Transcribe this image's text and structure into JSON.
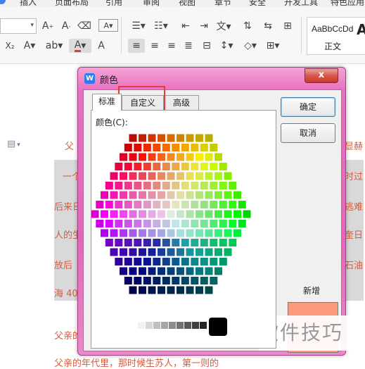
{
  "ribbon": {
    "menu_tabs": [
      "插入",
      "页面布局",
      "引用",
      "审阅",
      "视图",
      "章节",
      "安全",
      "开发工具",
      "特色应用"
    ],
    "font_size_value": "",
    "style_sample": "AaBbCcDd",
    "style_sample_big": "A",
    "style_name": "正文"
  },
  "document": {
    "lines": [
      "父",
      "一个大",
      "后来日",
      "人的生",
      "放后",
      "海 40",
      "父亲的",
      "父亲的年代里，那时候生苏人，第一则的"
    ],
    "right_lines": [
      "显赫",
      "时过",
      "逃难",
      "奎日",
      "石油"
    ]
  },
  "dialog": {
    "title": "颜色",
    "close_label": "x",
    "tabs": [
      "标准",
      "自定义",
      "高级"
    ],
    "colors_label": "颜色(C):",
    "ok_label": "确定",
    "cancel_label": "取消",
    "new_label": "新增",
    "new_color": "#fb9a7d",
    "current_color": "#fb9a7d"
  },
  "watermark": "软件技巧",
  "colors": {
    "accent": "#e83a3a",
    "dialog_frame": "#e466bb",
    "doc_text": "#d85a3c"
  }
}
